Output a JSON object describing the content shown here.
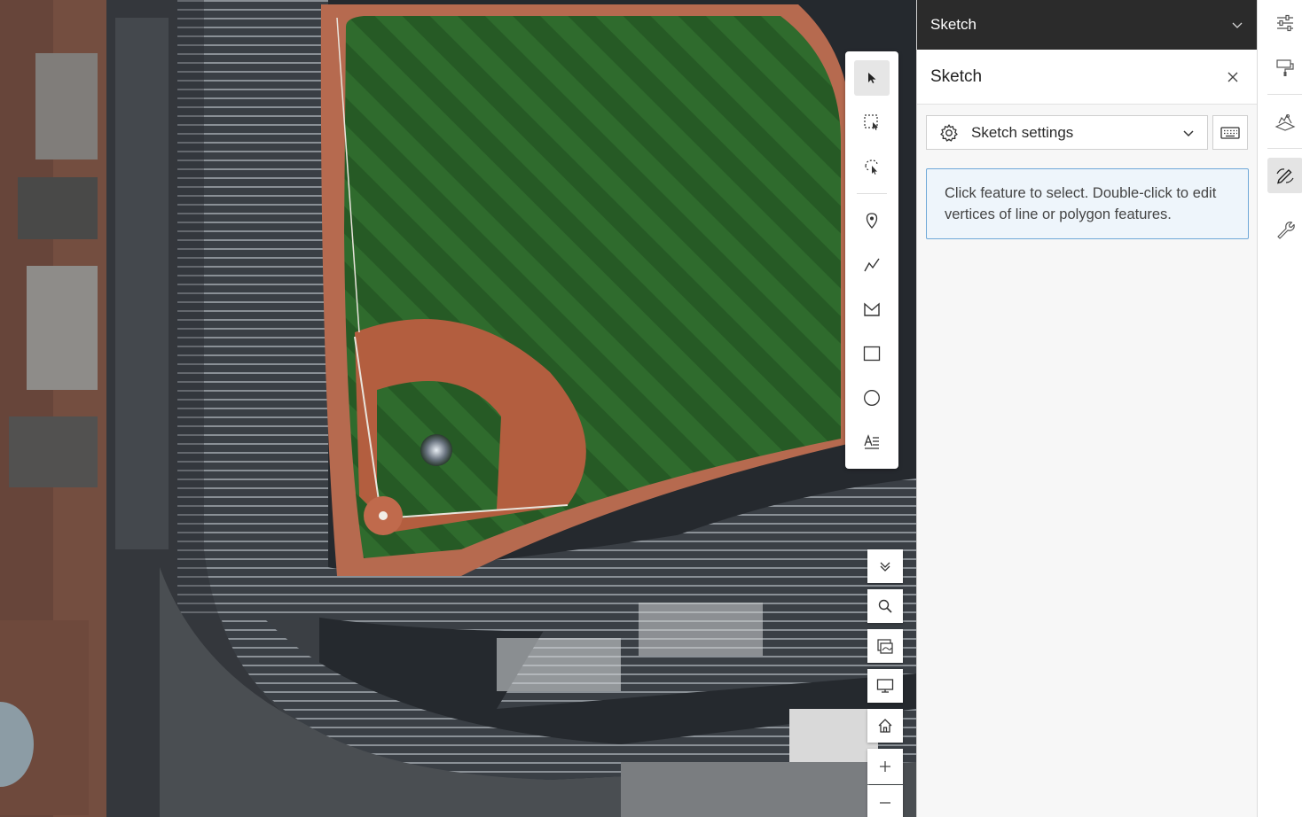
{
  "panel": {
    "header_title": "Sketch",
    "widget_title": "Sketch",
    "settings_label": "Sketch settings",
    "notice_text": "Click feature to select. Double-click to edit vertices of line or polygon features."
  },
  "colors": {
    "panel_header_bg": "#2b2b2b",
    "notice_bg": "#eef5fb",
    "notice_border": "#6fa8d8",
    "grass": "#2e6a2c",
    "infield_dirt": "#b35e3f"
  },
  "map_tools": [
    "select-cursor-icon",
    "rectangle-select-icon",
    "lasso-select-icon",
    "point-pin-icon",
    "polyline-icon",
    "polygon-icon",
    "rectangle-icon",
    "circle-icon",
    "text-icon"
  ],
  "nav_controls": [
    "collapse-icon",
    "search-icon",
    "basemap-gallery-icon",
    "presentation-icon",
    "home-icon",
    "zoom-in-icon",
    "zoom-out-icon"
  ],
  "action_bar": [
    "adjust-sliders-icon",
    "layer-style-icon",
    "map-layers-icon",
    "sketch-icon",
    "wrench-icon"
  ]
}
